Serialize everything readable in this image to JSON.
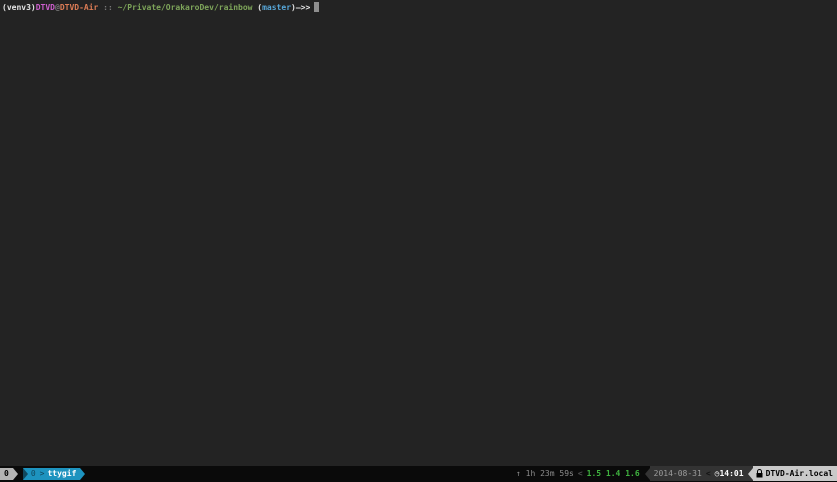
{
  "terminal": {
    "prompt": {
      "venv": "(venv3)",
      "user": "DTVD",
      "at": "@",
      "host": "DTVD-Air",
      "separator": " :: ",
      "path": "~/Private/OrakaroDev/rainbow",
      "branch_open": " (",
      "branch": "master",
      "branch_close": ")",
      "arrows": "—>>"
    }
  },
  "statusbar": {
    "left": {
      "session_index": "0",
      "window_index": "0",
      "window_separator": ">",
      "window_name": "ttygif"
    },
    "right": {
      "uptime_icon": "↑",
      "uptime": "1h 23m 59s",
      "separator_1": "<",
      "load_average": "1.5 1.4 1.6",
      "date": "2014-08-31",
      "separator_2": "<",
      "clock_icon": "◷",
      "time": "14:01",
      "lock_icon": "lock-icon",
      "hostname": "DTVD-Air.local"
    }
  },
  "colors": {
    "term-bg": "#232323",
    "bar-bg": "#0a0a0a",
    "magenta": "#ce5fce",
    "orange": "#dd7c55",
    "path-green": "#7ea55a",
    "branch-blue": "#56a6d8",
    "win-blue": "#1d93bf",
    "win-navy": "#10485e",
    "load-green": "#3fb23f",
    "silver": "#b4b4b4",
    "seg-gray": "#333333",
    "host-silver": "#c9c9c9",
    "cursor-gray": "#8f8f8f"
  }
}
